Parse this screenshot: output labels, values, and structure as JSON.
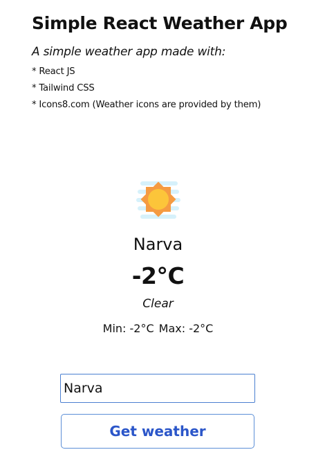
{
  "header": {
    "title": "Simple React Weather App",
    "subtitle": "A simple weather app made with:",
    "features": [
      "* React JS",
      "* Tailwind CSS",
      "* Icons8.com (Weather icons are provided by them)"
    ]
  },
  "weather": {
    "icon": "sun-haze-icon",
    "city": "Narva",
    "temperature": "-2°C",
    "description": "Clear",
    "min": "Min: -2°C",
    "max": "Max: -2°C"
  },
  "form": {
    "city_value": "Narva",
    "button_label": "Get weather"
  },
  "colors": {
    "button_text": "#2b56c9",
    "border": "#4a7fd0",
    "sun": "#fcc53a",
    "sun_rays": "#f59b42",
    "haze": "#d6f1fb"
  }
}
